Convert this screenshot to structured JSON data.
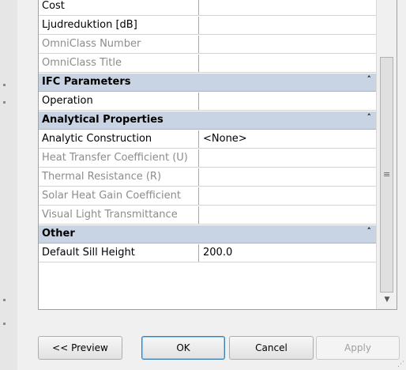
{
  "properties": {
    "rows_top": [
      {
        "name": "Cost",
        "value": "",
        "disabled": false
      },
      {
        "name": "Ljudreduktion [dB]",
        "value": "",
        "disabled": false
      },
      {
        "name": "OmniClass Number",
        "value": "",
        "disabled": true
      },
      {
        "name": "OmniClass Title",
        "value": "",
        "disabled": true
      }
    ],
    "groups": [
      {
        "title": "IFC Parameters",
        "rows": [
          {
            "name": "Operation",
            "value": "",
            "disabled": false
          }
        ]
      },
      {
        "title": "Analytical Properties",
        "rows": [
          {
            "name": "Analytic Construction",
            "value": "<None>",
            "disabled": false
          },
          {
            "name": "Heat Transfer Coefficient (U)",
            "value": "",
            "disabled": true
          },
          {
            "name": "Thermal Resistance (R)",
            "value": "",
            "disabled": true
          },
          {
            "name": "Solar Heat Gain Coefficient",
            "value": "",
            "disabled": true
          },
          {
            "name": "Visual Light Transmittance",
            "value": "",
            "disabled": true
          }
        ]
      },
      {
        "title": "Other",
        "rows": [
          {
            "name": "Default Sill Height",
            "value": "200.0",
            "disabled": false
          }
        ]
      }
    ],
    "collapse_glyph": "˄"
  },
  "buttons": {
    "preview": "<< Preview",
    "ok": "OK",
    "cancel": "Cancel",
    "apply": "Apply"
  },
  "colors": {
    "group_header": "#c8d4e4",
    "disabled_text": "#8c8c8c"
  }
}
